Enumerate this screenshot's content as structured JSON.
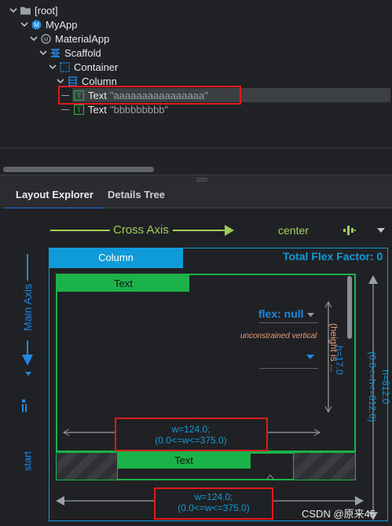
{
  "tree": {
    "rows": [
      {
        "label": "[root]",
        "value": ""
      },
      {
        "label": "MyApp",
        "value": ""
      },
      {
        "label": "MaterialApp",
        "value": ""
      },
      {
        "label": "Scaffold",
        "value": ""
      },
      {
        "label": "Container",
        "value": ""
      },
      {
        "label": "Column",
        "value": ""
      },
      {
        "label": "Text",
        "value": "\"aaaaaaaaaaaaaaaa\""
      },
      {
        "label": "Text",
        "value": "\"bbbbbbbbb\""
      }
    ]
  },
  "tabs": [
    "Layout Explorer",
    "Details Tree"
  ],
  "cross_axis": {
    "label": "Cross Axis",
    "alignment": "center"
  },
  "main_axis": {
    "label": "Main Axis",
    "alignment": "start"
  },
  "column_label": "Column",
  "total_flex": "Total Flex Factor: 0",
  "child1": {
    "label": "Text",
    "flex": "flex: null",
    "unconstrained": "unconstrained vertical",
    "height": "h=17.0",
    "height_note": "(height is ...",
    "width": "w=124.0;",
    "width_constraint": "(0.0<=w<=375.0)"
  },
  "child2": {
    "label": "Text"
  },
  "outer": {
    "height": "h=812.0",
    "height_constraint": "(0.0<=h<=812.0)",
    "width": "w=124.0;",
    "width_constraint": "(0.0<=w<=375.0)"
  },
  "watermark": "CSDN @原来45",
  "colors": {
    "accent": "#0f9bd7",
    "green": "#1bb24a",
    "red": "#e01b1b",
    "axis_green": "#9fce5b"
  }
}
